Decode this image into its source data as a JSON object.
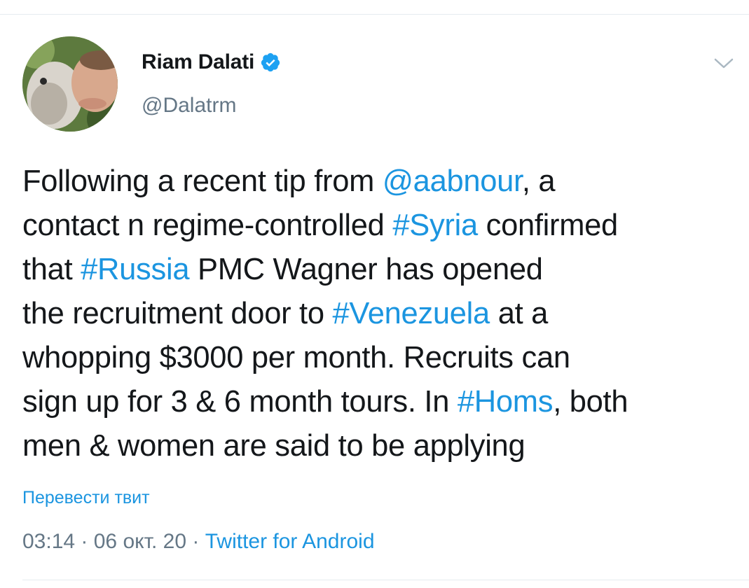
{
  "author": {
    "name": "Riam Dalati",
    "handle": "@Dalatrm",
    "verified": true
  },
  "tweet": {
    "lines": [
      [
        {
          "text": "Following a recent tip from ",
          "link": false
        },
        {
          "text": "@aabnour",
          "link": true
        },
        {
          "text": ", a",
          "link": false
        }
      ],
      [
        {
          "text": "contact n regime-controlled ",
          "link": false
        },
        {
          "text": "#Syria",
          "link": true
        },
        {
          "text": " confirmed",
          "link": false
        }
      ],
      [
        {
          "text": "that ",
          "link": false
        },
        {
          "text": "#Russia",
          "link": true
        },
        {
          "text": " PMC Wagner has opened",
          "link": false
        }
      ],
      [
        {
          "text": "the recruitment door to ",
          "link": false
        },
        {
          "text": "#Venezuela",
          "link": true
        },
        {
          "text": " at a",
          "link": false
        }
      ],
      [
        {
          "text": "whopping $3000 per month. Recruits can",
          "link": false
        }
      ],
      [
        {
          "text": "sign up for 3 & 6 month tours. In ",
          "link": false
        },
        {
          "text": "#Homs",
          "link": true
        },
        {
          "text": ", both",
          "link": false
        }
      ],
      [
        {
          "text": "men & women are said to be applying",
          "link": false
        }
      ]
    ]
  },
  "translate_label": "Перевести твит",
  "meta": {
    "time": "03:14",
    "separator": " · ",
    "date": "06 окт. 20",
    "source": "Twitter for Android"
  },
  "colors": {
    "link": "#1b95e0",
    "secondary_text": "#657786",
    "primary_text": "#14171a",
    "divider": "#e6ecf0"
  },
  "icons": {
    "verified": "verified-badge-icon",
    "caret": "chevron-down-icon"
  }
}
